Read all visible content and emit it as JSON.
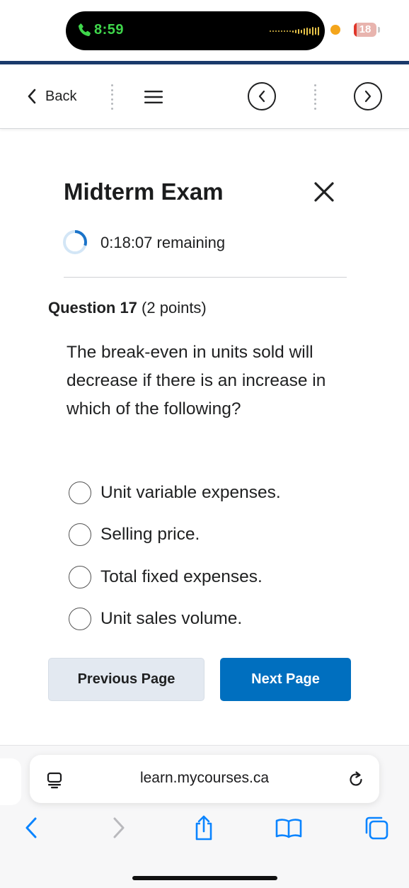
{
  "status_bar": {
    "time": "8:59",
    "battery_level": "18",
    "call_icon": "phone-icon",
    "accent_color": "#3fd64b"
  },
  "nav": {
    "back_label": "Back",
    "icons": [
      "chevron-left-icon",
      "hamburger-menu-icon",
      "circle-chevron-left-icon",
      "circle-chevron-right-icon"
    ]
  },
  "exam": {
    "title": "Midterm Exam",
    "time_remaining": "0:18:07 remaining",
    "timer_progress": 0.3,
    "question_number": "Question 17",
    "question_points": "(2 points)",
    "question_text": "The break-even in units sold will decrease if there is an increase in which of the following?",
    "options": [
      "Unit variable expenses.",
      "Selling price.",
      "Total fixed expenses.",
      "Unit sales volume."
    ],
    "selected_option": null
  },
  "buttons": {
    "previous": "Previous Page",
    "next": "Next Page",
    "next_color": "#006fbf"
  },
  "safari": {
    "url": "learn.mycourses.ca",
    "icons": [
      "page-settings-icon",
      "reload-icon",
      "back-arrow-icon",
      "forward-arrow-icon",
      "share-icon",
      "bookmarks-icon",
      "tabs-icon"
    ]
  }
}
